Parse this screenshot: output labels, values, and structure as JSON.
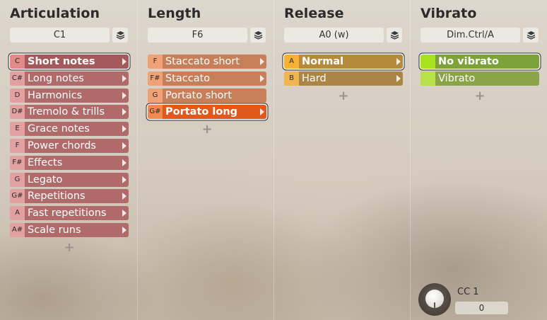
{
  "columns": [
    {
      "title": "Articulation",
      "keyswitch": "C1",
      "items": [
        {
          "key": "C",
          "label": "Short notes"
        },
        {
          "key": "C#",
          "label": "Long notes"
        },
        {
          "key": "D",
          "label": "Harmonics"
        },
        {
          "key": "D#",
          "label": "Tremolo & trills"
        },
        {
          "key": "E",
          "label": "Grace notes"
        },
        {
          "key": "F",
          "label": "Power chords"
        },
        {
          "key": "F#",
          "label": "Effects"
        },
        {
          "key": "G",
          "label": "Legato"
        },
        {
          "key": "G#",
          "label": "Repetitions"
        },
        {
          "key": "A",
          "label": "Fast repetitions"
        },
        {
          "key": "A#",
          "label": "Scale runs"
        }
      ],
      "selected": "Short notes",
      "add_label": "+"
    },
    {
      "title": "Length",
      "keyswitch": "F6",
      "items": [
        {
          "key": "F",
          "label": "Staccato short"
        },
        {
          "key": "F#",
          "label": "Staccato"
        },
        {
          "key": "G",
          "label": "Portato short"
        },
        {
          "key": "G#",
          "label": "Portato long"
        }
      ],
      "selected": "Portato long",
      "add_label": "+"
    },
    {
      "title": "Release",
      "keyswitch": "A0 (w)",
      "items": [
        {
          "key": "A",
          "label": "Normal"
        },
        {
          "key": "B",
          "label": "Hard"
        }
      ],
      "selected": "Normal",
      "add_label": "+"
    },
    {
      "title": "Vibrato",
      "keyswitch": "Dim.Ctrl/A",
      "items": [
        {
          "key": "",
          "label": "No vibrato"
        },
        {
          "key": "",
          "label": "Vibrato"
        }
      ],
      "selected": "No vibrato",
      "add_label": "+"
    }
  ],
  "cc": {
    "label": "CC 1",
    "value": "0"
  },
  "icons": {
    "layers": "layers-icon",
    "submenu": "chevron-right-icon",
    "knob": "knob-icon"
  },
  "colors": {
    "articulation": "#b06a6a",
    "length": "#c77f5a",
    "length_selected": "#e0581c",
    "release": "#aa8545",
    "vibrato": "#8aa447",
    "vibrato_selected": "#a6e31c"
  }
}
